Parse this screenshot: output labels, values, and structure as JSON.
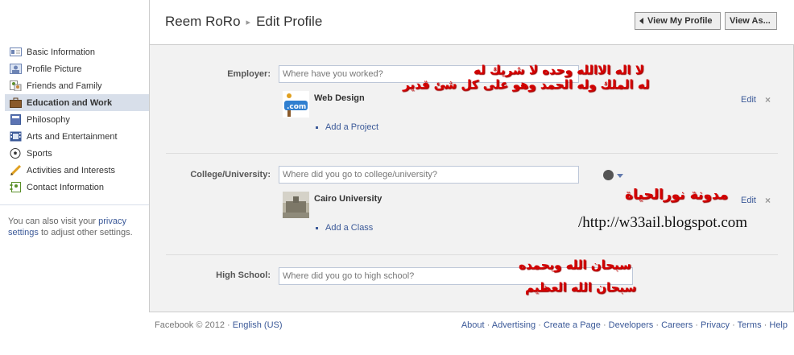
{
  "header": {
    "user_name": "Reem RoRo",
    "separator": "▸",
    "page_title": "Edit Profile",
    "view_profile_label": "View My Profile",
    "view_as_label": "View As..."
  },
  "sidebar": {
    "items": [
      {
        "label": "Basic Information",
        "icon": "id-card-icon"
      },
      {
        "label": "Profile Picture",
        "icon": "picture-icon"
      },
      {
        "label": "Friends and Family",
        "icon": "friends-icon"
      },
      {
        "label": "Education and Work",
        "icon": "briefcase-icon",
        "active": true
      },
      {
        "label": "Philosophy",
        "icon": "book-icon"
      },
      {
        "label": "Arts and Entertainment",
        "icon": "film-icon"
      },
      {
        "label": "Sports",
        "icon": "soccer-ball-icon"
      },
      {
        "label": "Activities and Interests",
        "icon": "pencil-icon"
      },
      {
        "label": "Contact Information",
        "icon": "contact-icon"
      }
    ],
    "note_prefix": "You can also visit your",
    "note_link": "privacy settings",
    "note_suffix": "to adjust other settings."
  },
  "employer": {
    "label": "Employer:",
    "placeholder": "Where have you worked?",
    "entry": "Web Design",
    "add_label": "Add a Project",
    "edit_label": "Edit",
    "remove": "×"
  },
  "college": {
    "label": "College/University:",
    "placeholder": "Where did you go to college/university?",
    "entry": "Cairo University",
    "add_label": "Add a Class",
    "edit_label": "Edit",
    "remove": "×"
  },
  "highschool": {
    "label": "High School:",
    "placeholder": "Where did you go to high school?"
  },
  "overlay": {
    "line1": "لا اله الاالله وحده لا شريك له",
    "line2": "له الملك وله الحمد وهو على كل شئ قدير",
    "blog_name": "مدونة نورالحياة",
    "url": "/http://w33ail.blogspot.com",
    "line3": "سبحان الله وبحمده",
    "line4": "سبحان الله العظيم"
  },
  "footer": {
    "copyright": "Facebook © 2012 ·",
    "language": "English (US)",
    "links": [
      "About",
      "Advertising",
      "Create a Page",
      "Developers",
      "Careers",
      "Privacy",
      "Terms",
      "Help"
    ]
  },
  "colors": {
    "link": "#3b5998",
    "active_nav": "#d8dfea",
    "panel_bg": "#f2f2f2",
    "overlay_red": "#d40000"
  }
}
